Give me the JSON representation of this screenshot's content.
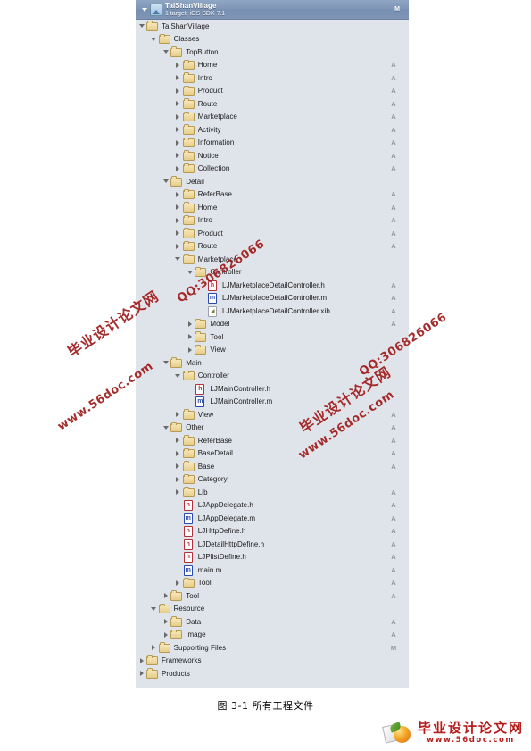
{
  "project": {
    "name": "TaiShanVillage",
    "subtitle": "1 target, iOS SDK 7.1",
    "status": "M",
    "icon": "xcode-project-icon"
  },
  "tree": [
    {
      "depth": 1,
      "label": "TaiShanVillage",
      "icon": "folder",
      "twisty": "down",
      "status": ""
    },
    {
      "depth": 2,
      "label": "Classes",
      "icon": "folder",
      "twisty": "down",
      "status": ""
    },
    {
      "depth": 3,
      "label": "TopButton",
      "icon": "folder",
      "twisty": "down",
      "status": ""
    },
    {
      "depth": 4,
      "label": "Home",
      "icon": "folder",
      "twisty": "right",
      "status": "A"
    },
    {
      "depth": 4,
      "label": "Intro",
      "icon": "folder",
      "twisty": "right",
      "status": "A"
    },
    {
      "depth": 4,
      "label": "Product",
      "icon": "folder",
      "twisty": "right",
      "status": "A"
    },
    {
      "depth": 4,
      "label": "Route",
      "icon": "folder",
      "twisty": "right",
      "status": "A"
    },
    {
      "depth": 4,
      "label": "Marketplace",
      "icon": "folder",
      "twisty": "right",
      "status": "A"
    },
    {
      "depth": 4,
      "label": "Activity",
      "icon": "folder",
      "twisty": "right",
      "status": "A"
    },
    {
      "depth": 4,
      "label": "Information",
      "icon": "folder",
      "twisty": "right",
      "status": "A"
    },
    {
      "depth": 4,
      "label": "Notice",
      "icon": "folder",
      "twisty": "right",
      "status": "A"
    },
    {
      "depth": 4,
      "label": "Collection",
      "icon": "folder",
      "twisty": "right",
      "status": "A"
    },
    {
      "depth": 3,
      "label": "Detail",
      "icon": "folder",
      "twisty": "down",
      "status": ""
    },
    {
      "depth": 4,
      "label": "ReferBase",
      "icon": "folder",
      "twisty": "right",
      "status": "A"
    },
    {
      "depth": 4,
      "label": "Home",
      "icon": "folder",
      "twisty": "right",
      "status": "A"
    },
    {
      "depth": 4,
      "label": "Intro",
      "icon": "folder",
      "twisty": "right",
      "status": "A"
    },
    {
      "depth": 4,
      "label": "Product",
      "icon": "folder",
      "twisty": "right",
      "status": "A"
    },
    {
      "depth": 4,
      "label": "Route",
      "icon": "folder",
      "twisty": "right",
      "status": "A"
    },
    {
      "depth": 4,
      "label": "Marketplace",
      "icon": "folder",
      "twisty": "down",
      "status": ""
    },
    {
      "depth": 5,
      "label": "Controller",
      "icon": "folder",
      "twisty": "down",
      "status": ""
    },
    {
      "depth": 6,
      "label": "LJMarketplaceDetailController.h",
      "icon": "h",
      "twisty": "none",
      "status": "A"
    },
    {
      "depth": 6,
      "label": "LJMarketplaceDetailController.m",
      "icon": "m",
      "twisty": "none",
      "status": "A"
    },
    {
      "depth": 6,
      "label": "LJMarketplaceDetailController.xib",
      "icon": "xib",
      "twisty": "none",
      "status": "A"
    },
    {
      "depth": 5,
      "label": "Model",
      "icon": "folder",
      "twisty": "right",
      "status": "A"
    },
    {
      "depth": 5,
      "label": "Tool",
      "icon": "folder",
      "twisty": "right",
      "status": ""
    },
    {
      "depth": 5,
      "label": "View",
      "icon": "folder",
      "twisty": "right",
      "status": ""
    },
    {
      "depth": 3,
      "label": "Main",
      "icon": "folder",
      "twisty": "down",
      "status": ""
    },
    {
      "depth": 4,
      "label": "Controller",
      "icon": "folder",
      "twisty": "down",
      "status": ""
    },
    {
      "depth": 5,
      "label": "LJMainController.h",
      "icon": "h",
      "twisty": "none",
      "status": ""
    },
    {
      "depth": 5,
      "label": "LJMainController.m",
      "icon": "m",
      "twisty": "none",
      "status": ""
    },
    {
      "depth": 4,
      "label": "View",
      "icon": "folder",
      "twisty": "right",
      "status": "A"
    },
    {
      "depth": 3,
      "label": "Other",
      "icon": "folder",
      "twisty": "down",
      "status": "A"
    },
    {
      "depth": 4,
      "label": "ReferBase",
      "icon": "folder",
      "twisty": "right",
      "status": "A"
    },
    {
      "depth": 4,
      "label": "BaseDetail",
      "icon": "folder",
      "twisty": "right",
      "status": "A"
    },
    {
      "depth": 4,
      "label": "Base",
      "icon": "folder",
      "twisty": "right",
      "status": "A"
    },
    {
      "depth": 4,
      "label": "Category",
      "icon": "folder",
      "twisty": "right",
      "status": ""
    },
    {
      "depth": 4,
      "label": "Lib",
      "icon": "folder",
      "twisty": "right",
      "status": "A"
    },
    {
      "depth": 4,
      "label": "LJAppDelegate.h",
      "icon": "h",
      "twisty": "none",
      "status": "A"
    },
    {
      "depth": 4,
      "label": "LJAppDelegate.m",
      "icon": "m",
      "twisty": "none",
      "status": "A"
    },
    {
      "depth": 4,
      "label": "LJHttpDefine.h",
      "icon": "h",
      "twisty": "none",
      "status": "A"
    },
    {
      "depth": 4,
      "label": "LJDetailHttpDefine.h",
      "icon": "h",
      "twisty": "none",
      "status": "A"
    },
    {
      "depth": 4,
      "label": "LJPlistDefine.h",
      "icon": "h",
      "twisty": "none",
      "status": "A"
    },
    {
      "depth": 4,
      "label": "main.m",
      "icon": "m",
      "twisty": "none",
      "status": "A"
    },
    {
      "depth": 4,
      "label": "Tool",
      "icon": "folder",
      "twisty": "right",
      "status": "A"
    },
    {
      "depth": 3,
      "label": "Tool",
      "icon": "folder",
      "twisty": "right",
      "status": "A"
    },
    {
      "depth": 2,
      "label": "Resource",
      "icon": "folder",
      "twisty": "down",
      "status": ""
    },
    {
      "depth": 3,
      "label": "Data",
      "icon": "folder",
      "twisty": "right",
      "status": "A"
    },
    {
      "depth": 3,
      "label": "Image",
      "icon": "folder",
      "twisty": "right",
      "status": "A"
    },
    {
      "depth": 2,
      "label": "Supporting Files",
      "icon": "folder",
      "twisty": "right",
      "status": "M"
    },
    {
      "depth": 1,
      "label": "Frameworks",
      "icon": "folder",
      "twisty": "right",
      "status": ""
    },
    {
      "depth": 1,
      "label": "Products",
      "icon": "folder",
      "twisty": "right",
      "status": ""
    }
  ],
  "caption": "图 3-1  所有工程文件",
  "watermarks": [
    {
      "cn": "毕业设计论文网",
      "qq": "QQ:306826066",
      "url": "www.56doc.com"
    },
    {
      "cn": "毕业设计论文网",
      "qq": "QQ:306826066",
      "url": "www.56doc.com"
    }
  ],
  "footer_logo": {
    "title": "毕业设计论文网",
    "url": "www.56doc.com"
  },
  "colors": {
    "panel_bg": "#dfe3ea",
    "header_blue": "#7e95b6",
    "folder_yellow": "#e6cd88",
    "watermark_red": "#9e1b1b",
    "logo_red": "#b71c1c"
  }
}
